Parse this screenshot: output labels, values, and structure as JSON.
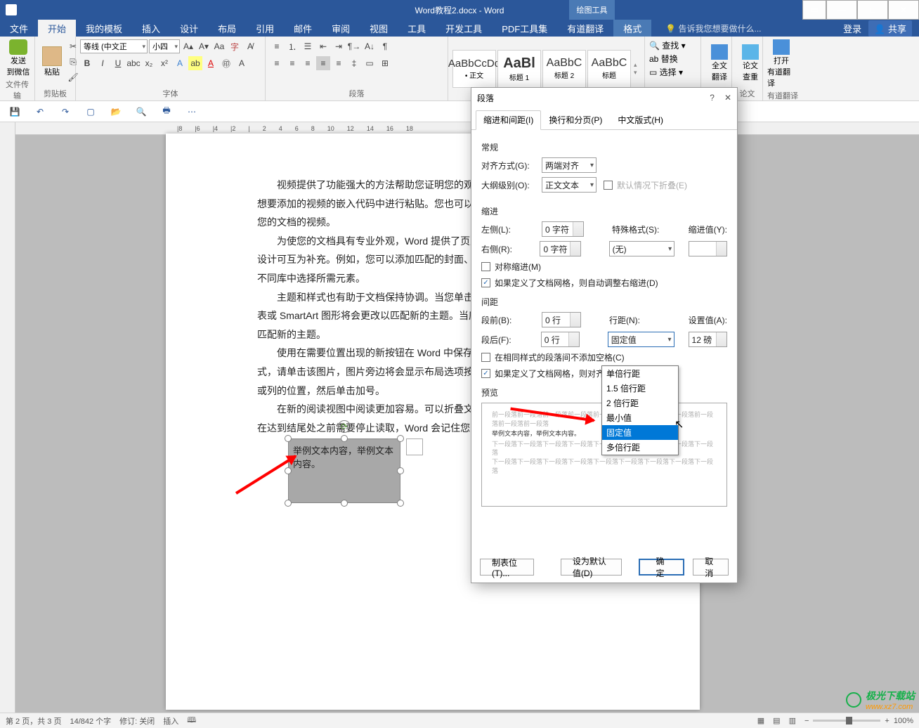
{
  "title": "Word教程2.docx - Word",
  "tool_context": "绘图工具",
  "win_buttons": {
    "help": "?",
    "min": "—",
    "max": "□",
    "close": "✕"
  },
  "tabs": {
    "file": "文件",
    "home": "开始",
    "tmpl": "我的模板",
    "insert": "插入",
    "design": "设计",
    "layout": "布局",
    "ref": "引用",
    "mail": "邮件",
    "review": "审阅",
    "view": "视图",
    "tools": "工具",
    "dev": "开发工具",
    "pdf": "PDF工具集",
    "trans": "有道翻译",
    "format": "格式"
  },
  "tellme": "告诉我您想要做什么...",
  "login": "登录",
  "share": "共享",
  "ribbon": {
    "send": {
      "l1": "发送",
      "l2": "到微信",
      "grp": "文件传输"
    },
    "paste": {
      "label": "粘贴",
      "grp": "剪贴板"
    },
    "font": {
      "name": "等线 (中文正",
      "size": "小四",
      "grp": "字体"
    },
    "para": {
      "grp": "段落"
    },
    "styles": [
      {
        "prev": "AaBbCcDd",
        "name": "• 正文"
      },
      {
        "prev": "AaBl",
        "name": "标题 1"
      },
      {
        "prev": "AaBbC",
        "name": "标题 2"
      },
      {
        "prev": "AaBbC",
        "name": "标题"
      }
    ],
    "edit": {
      "find": "查找",
      "replace": "替换",
      "select": "选择"
    },
    "trans": {
      "l1": "全文",
      "l2": "翻译"
    },
    "paper": {
      "l1": "论文",
      "l2": "查重",
      "grp": "论文"
    },
    "open": {
      "l1": "打开",
      "l2": "有道翻译",
      "grp": "有道翻译"
    }
  },
  "ruler": [
    "|2",
    "|",
    "10",
    "|",
    "|8",
    "",
    "|6",
    "|",
    "|4",
    "",
    "|2",
    "",
    "|",
    "",
    "2",
    "",
    "4",
    "",
    "6",
    "",
    "8",
    "",
    "10",
    "",
    "12",
    "",
    "14",
    "",
    "16",
    "",
    "18"
  ],
  "doc": {
    "p1": "视频提供了功能强大的方法帮助您证明您的观点。当您单击联机视频时，可以在想要添加的视频的嵌入代码中进行粘贴。您也可以键入一个关键字以联机搜索最适合您的文档的视频。",
    "p2": "为使您的文档具有专业外观，Word 提供了页眉、页脚、封面和文本框设计，这些设计可互为补充。例如，您可以添加匹配的封面、页眉和提要栏。单击\"插入\"，然后从不同库中选择所需元素。",
    "p3": "主题和样式也有助于文档保持协调。当您单击设计并选择新的主题时，图片、图表或 SmartArt 图形将会更改以匹配新的主题。当应用样式时，您的标题会进行更改以匹配新的主题。",
    "p4": "使用在需要位置出现的新按钮在 Word 中保存时间。若要更改图片适应文档的方式，请单击该图片，图片旁边将会显示布局选项按钮。当处理表格时，单击要添加行或列的位置，然后单击加号。",
    "p5": "在新的阅读视图中阅读更加容易。可以折叠文档某些部分并关注所需文本。如果在达到结尾处之前需要停止读取，Word 会记住您的停止位置 - 即使在另一个设备上。",
    "tb": "举例文本内容，举例文本内容。"
  },
  "dialog": {
    "title": "段落",
    "tabs": {
      "t1": "缩进和间距(I)",
      "t2": "换行和分页(P)",
      "t3": "中文版式(H)"
    },
    "general": "常规",
    "align_l": "对齐方式(G):",
    "align_v": "两端对齐",
    "outline_l": "大纲级别(O):",
    "outline_v": "正文文本",
    "collapse": "默认情况下折叠(E)",
    "indent": "缩进",
    "left_l": "左侧(L):",
    "left_v": "0 字符",
    "right_l": "右侧(R):",
    "right_v": "0 字符",
    "special_l": "特殊格式(S):",
    "special_v": "(无)",
    "indval_l": "缩进值(Y):",
    "indval_v": "",
    "sym": "对称缩进(M)",
    "grid1": "如果定义了文档网格，则自动调整右缩进(D)",
    "spacing": "间距",
    "before_l": "段前(B):",
    "before_v": "0 行",
    "after_l": "段后(F):",
    "after_v": "0 行",
    "line_l": "行距(N):",
    "line_v": "固定值",
    "setv_l": "设置值(A):",
    "setv_v": "12 磅",
    "nosame": "在相同样式的段落间不添加空格(C)",
    "grid2": "如果定义了文档网格，则对齐到网格(W)",
    "preview": "预览",
    "prev_txt1": "前一段落前一段落前一段落前一段落前一段落前一段落前一段落前一段落前一段落前一段落前一段落",
    "prev_txt2": "举例文本内容，举例文本内容。",
    "prev_txt3": "下一段落下一段落下一段落下一段落下一段落下一段落下一段落下一段落下一段落",
    "tabstops": "制表位(T)...",
    "default": "设为默认值(D)",
    "ok": "确定",
    "cancel": "取消",
    "options": [
      "单倍行距",
      "1.5 倍行距",
      "2 倍行距",
      "最小值",
      "固定值",
      "多倍行距"
    ]
  },
  "status": {
    "page": "第 2 页，共 3 页",
    "words": "14/842 个字",
    "track": "修订: 关闭",
    "ins": "插入",
    "zoom": "100%"
  },
  "watermark": {
    "a": "极光下载站",
    "b": "www.xz7.com"
  }
}
